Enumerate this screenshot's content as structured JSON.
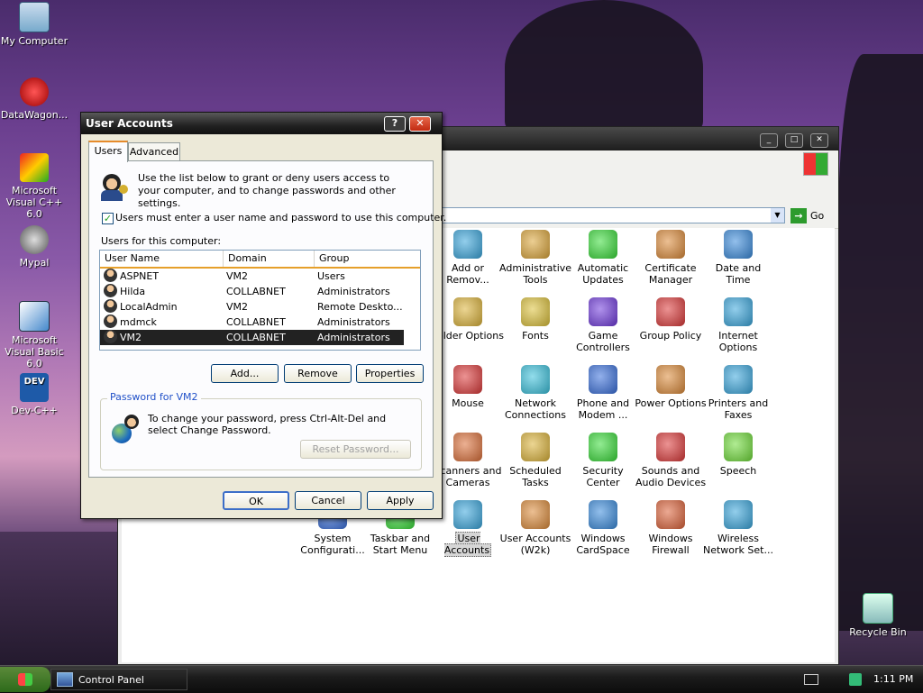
{
  "desktop": {
    "icons": [
      {
        "label": "My Computer"
      },
      {
        "label": "DataWagon..."
      },
      {
        "label": "Microsoft Visual C++ 6.0"
      },
      {
        "label": "Mypal"
      },
      {
        "label": "Microsoft Visual Basic 6.0"
      },
      {
        "label": "Dev-C++"
      },
      {
        "label": "Recycle Bin"
      }
    ]
  },
  "taskbar": {
    "task_label": "Control Panel",
    "clock": "1:11 PM"
  },
  "control_panel": {
    "address_go": "Go",
    "items": [
      {
        "label": "Add or Remov...",
        "icon": "add-remove-icon"
      },
      {
        "label": "Administrative Tools",
        "icon": "admin-tools-icon"
      },
      {
        "label": "Automatic Updates",
        "icon": "windows-flag-icon"
      },
      {
        "label": "Certificate Manager",
        "icon": "certificate-icon"
      },
      {
        "label": "Date and Time",
        "icon": "clock-icon"
      },
      {
        "label": "Folder Options",
        "icon": "folder-icon"
      },
      {
        "label": "Fonts",
        "icon": "fonts-folder-icon"
      },
      {
        "label": "Game Controllers",
        "icon": "gamepad-icon"
      },
      {
        "label": "Group Policy",
        "icon": "group-policy-icon"
      },
      {
        "label": "Internet Options",
        "icon": "globe-icon"
      },
      {
        "label": "Mouse",
        "icon": "mouse-icon"
      },
      {
        "label": "Network Connections",
        "icon": "network-icon"
      },
      {
        "label": "Phone and Modem ...",
        "icon": "phone-icon"
      },
      {
        "label": "Power Options",
        "icon": "power-icon"
      },
      {
        "label": "Printers and Faxes",
        "icon": "printer-icon"
      },
      {
        "label": "Scanners and Cameras",
        "icon": "scanner-icon"
      },
      {
        "label": "Scheduled Tasks",
        "icon": "scheduled-tasks-icon"
      },
      {
        "label": "Security Center",
        "icon": "shield-icon"
      },
      {
        "label": "Sounds and Audio Devices",
        "icon": "speaker-icon"
      },
      {
        "label": "Speech",
        "icon": "speech-icon"
      },
      {
        "label": "System Configurati...",
        "icon": "system-config-icon"
      },
      {
        "label": "Taskbar and Start Menu",
        "icon": "taskbar-icon"
      },
      {
        "label": "User Accounts",
        "icon": "users-icon"
      },
      {
        "label": "User Accounts (W2k)",
        "icon": "user-key-icon"
      },
      {
        "label": "Windows CardSpace",
        "icon": "cardspace-icon"
      },
      {
        "label": "Windows Firewall",
        "icon": "firewall-icon"
      },
      {
        "label": "Wireless Network Set...",
        "icon": "wireless-icon"
      }
    ]
  },
  "dialog": {
    "title": "User Accounts",
    "help_glyph": "?",
    "close_glyph": "✕",
    "tabs": [
      "Users",
      "Advanced"
    ],
    "intro": "Use the list below to grant or deny users access to your computer, and to change passwords and other settings.",
    "checkbox_label": "Users must enter a user name and password to use this computer.",
    "list_caption": "Users for this computer:",
    "columns": [
      "User Name",
      "Domain",
      "Group"
    ],
    "rows": [
      {
        "name": "ASPNET",
        "domain": "VM2",
        "group": "Users"
      },
      {
        "name": "Hilda",
        "domain": "COLLABNET",
        "group": "Administrators"
      },
      {
        "name": "LocalAdmin",
        "domain": "VM2",
        "group": "Remote Deskto..."
      },
      {
        "name": "mdmck",
        "domain": "COLLABNET",
        "group": "Administrators"
      },
      {
        "name": "VM2",
        "domain": "COLLABNET",
        "group": "Administrators"
      }
    ],
    "buttons": {
      "add": "Add...",
      "remove": "Remove",
      "properties": "Properties"
    },
    "password_group_title": "Password for VM2",
    "password_text": "To change your password, press Ctrl-Alt-Del and select Change Password.",
    "reset_password": "Reset Password...",
    "ok": "OK",
    "cancel": "Cancel",
    "apply": "Apply"
  }
}
